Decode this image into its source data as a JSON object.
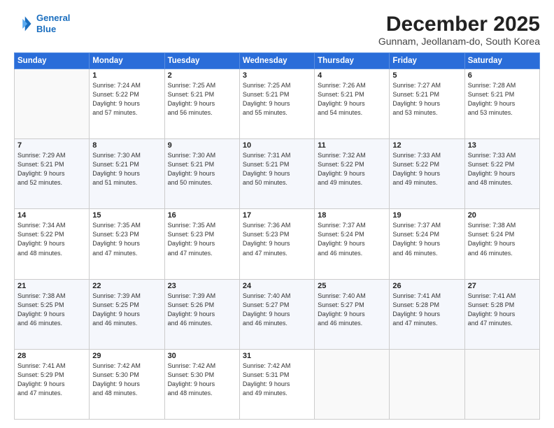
{
  "header": {
    "logo_line1": "General",
    "logo_line2": "Blue",
    "title": "December 2025",
    "subtitle": "Gunnam, Jeollanam-do, South Korea"
  },
  "weekdays": [
    "Sunday",
    "Monday",
    "Tuesday",
    "Wednesday",
    "Thursday",
    "Friday",
    "Saturday"
  ],
  "weeks": [
    [
      {
        "day": "",
        "info": ""
      },
      {
        "day": "1",
        "info": "Sunrise: 7:24 AM\nSunset: 5:22 PM\nDaylight: 9 hours\nand 57 minutes."
      },
      {
        "day": "2",
        "info": "Sunrise: 7:25 AM\nSunset: 5:21 PM\nDaylight: 9 hours\nand 56 minutes."
      },
      {
        "day": "3",
        "info": "Sunrise: 7:25 AM\nSunset: 5:21 PM\nDaylight: 9 hours\nand 55 minutes."
      },
      {
        "day": "4",
        "info": "Sunrise: 7:26 AM\nSunset: 5:21 PM\nDaylight: 9 hours\nand 54 minutes."
      },
      {
        "day": "5",
        "info": "Sunrise: 7:27 AM\nSunset: 5:21 PM\nDaylight: 9 hours\nand 53 minutes."
      },
      {
        "day": "6",
        "info": "Sunrise: 7:28 AM\nSunset: 5:21 PM\nDaylight: 9 hours\nand 53 minutes."
      }
    ],
    [
      {
        "day": "7",
        "info": "Sunrise: 7:29 AM\nSunset: 5:21 PM\nDaylight: 9 hours\nand 52 minutes."
      },
      {
        "day": "8",
        "info": "Sunrise: 7:30 AM\nSunset: 5:21 PM\nDaylight: 9 hours\nand 51 minutes."
      },
      {
        "day": "9",
        "info": "Sunrise: 7:30 AM\nSunset: 5:21 PM\nDaylight: 9 hours\nand 50 minutes."
      },
      {
        "day": "10",
        "info": "Sunrise: 7:31 AM\nSunset: 5:21 PM\nDaylight: 9 hours\nand 50 minutes."
      },
      {
        "day": "11",
        "info": "Sunrise: 7:32 AM\nSunset: 5:22 PM\nDaylight: 9 hours\nand 49 minutes."
      },
      {
        "day": "12",
        "info": "Sunrise: 7:33 AM\nSunset: 5:22 PM\nDaylight: 9 hours\nand 49 minutes."
      },
      {
        "day": "13",
        "info": "Sunrise: 7:33 AM\nSunset: 5:22 PM\nDaylight: 9 hours\nand 48 minutes."
      }
    ],
    [
      {
        "day": "14",
        "info": "Sunrise: 7:34 AM\nSunset: 5:22 PM\nDaylight: 9 hours\nand 48 minutes."
      },
      {
        "day": "15",
        "info": "Sunrise: 7:35 AM\nSunset: 5:23 PM\nDaylight: 9 hours\nand 47 minutes."
      },
      {
        "day": "16",
        "info": "Sunrise: 7:35 AM\nSunset: 5:23 PM\nDaylight: 9 hours\nand 47 minutes."
      },
      {
        "day": "17",
        "info": "Sunrise: 7:36 AM\nSunset: 5:23 PM\nDaylight: 9 hours\nand 47 minutes."
      },
      {
        "day": "18",
        "info": "Sunrise: 7:37 AM\nSunset: 5:24 PM\nDaylight: 9 hours\nand 46 minutes."
      },
      {
        "day": "19",
        "info": "Sunrise: 7:37 AM\nSunset: 5:24 PM\nDaylight: 9 hours\nand 46 minutes."
      },
      {
        "day": "20",
        "info": "Sunrise: 7:38 AM\nSunset: 5:24 PM\nDaylight: 9 hours\nand 46 minutes."
      }
    ],
    [
      {
        "day": "21",
        "info": "Sunrise: 7:38 AM\nSunset: 5:25 PM\nDaylight: 9 hours\nand 46 minutes."
      },
      {
        "day": "22",
        "info": "Sunrise: 7:39 AM\nSunset: 5:25 PM\nDaylight: 9 hours\nand 46 minutes."
      },
      {
        "day": "23",
        "info": "Sunrise: 7:39 AM\nSunset: 5:26 PM\nDaylight: 9 hours\nand 46 minutes."
      },
      {
        "day": "24",
        "info": "Sunrise: 7:40 AM\nSunset: 5:27 PM\nDaylight: 9 hours\nand 46 minutes."
      },
      {
        "day": "25",
        "info": "Sunrise: 7:40 AM\nSunset: 5:27 PM\nDaylight: 9 hours\nand 46 minutes."
      },
      {
        "day": "26",
        "info": "Sunrise: 7:41 AM\nSunset: 5:28 PM\nDaylight: 9 hours\nand 47 minutes."
      },
      {
        "day": "27",
        "info": "Sunrise: 7:41 AM\nSunset: 5:28 PM\nDaylight: 9 hours\nand 47 minutes."
      }
    ],
    [
      {
        "day": "28",
        "info": "Sunrise: 7:41 AM\nSunset: 5:29 PM\nDaylight: 9 hours\nand 47 minutes."
      },
      {
        "day": "29",
        "info": "Sunrise: 7:42 AM\nSunset: 5:30 PM\nDaylight: 9 hours\nand 48 minutes."
      },
      {
        "day": "30",
        "info": "Sunrise: 7:42 AM\nSunset: 5:30 PM\nDaylight: 9 hours\nand 48 minutes."
      },
      {
        "day": "31",
        "info": "Sunrise: 7:42 AM\nSunset: 5:31 PM\nDaylight: 9 hours\nand 49 minutes."
      },
      {
        "day": "",
        "info": ""
      },
      {
        "day": "",
        "info": ""
      },
      {
        "day": "",
        "info": ""
      }
    ]
  ]
}
